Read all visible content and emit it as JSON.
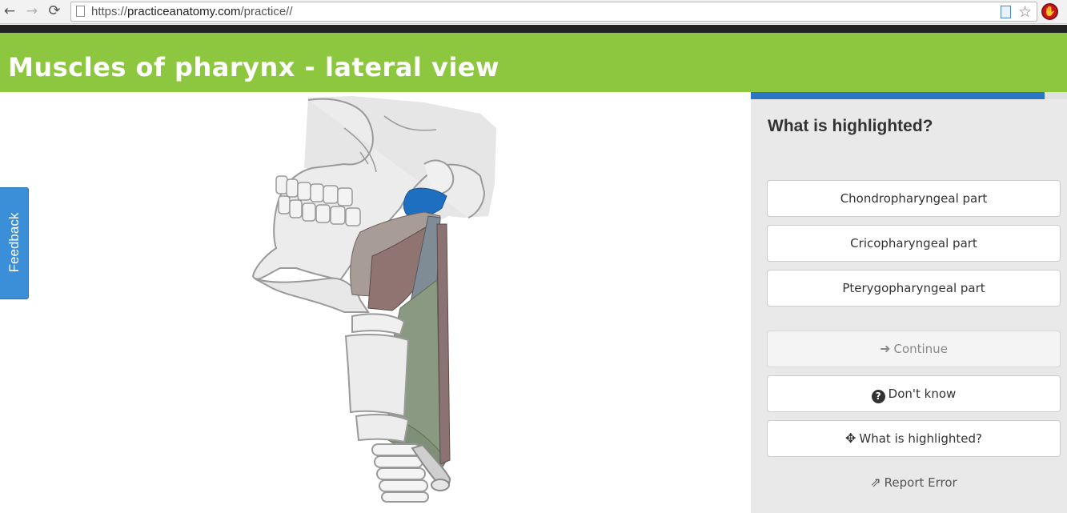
{
  "browser": {
    "url_scheme": "https://",
    "url_host": "practiceanatomy.com",
    "url_path": "/practice//",
    "back_icon": "←",
    "forward_icon": "→",
    "reload_icon": "⟳",
    "star_icon": "☆"
  },
  "header": {
    "title": "Muscles of pharynx - lateral view"
  },
  "feedback": {
    "label": "Feedback"
  },
  "panel": {
    "progress": 0.93,
    "question": "What is highlighted?",
    "options": [
      {
        "label": "Chondropharyngeal part"
      },
      {
        "label": "Cricopharyngeal part"
      },
      {
        "label": "Pterygopharyngeal part"
      }
    ],
    "continue_label": "Continue",
    "continue_icon": "➜",
    "dont_know_label": "Don't know",
    "dont_know_icon": "?",
    "what_label": "What is highlighted?",
    "what_icon": "✥",
    "report_label": "Report Error",
    "report_icon": "⇗"
  },
  "colors": {
    "header_green": "#8dc63f",
    "accent_blue": "#2d76c6",
    "highlight_blue": "#1f6fc1",
    "panel_grey": "#e9e9e9"
  }
}
